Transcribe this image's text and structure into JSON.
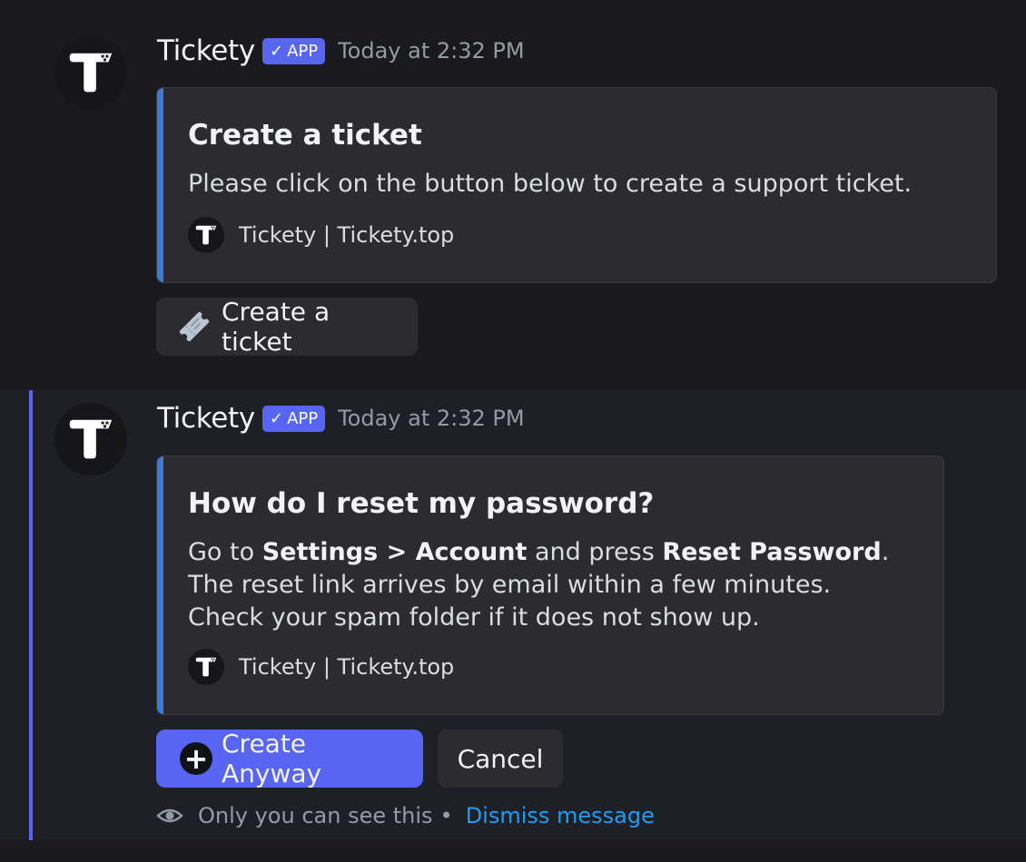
{
  "messages": [
    {
      "author": "Tickety",
      "badge": "APP",
      "badge_icon": "✓",
      "timestamp": "Today at 2:32 PM",
      "embed": {
        "title": "Create a ticket",
        "description": "Please click on the button below to create a support ticket.",
        "footer": "Tickety | Tickety.top",
        "accent_color": "#3a7bd5"
      },
      "buttons": [
        {
          "label": "Create a ticket",
          "icon": "ticket-icon",
          "style": "secondary"
        }
      ]
    },
    {
      "author": "Tickety",
      "badge": "APP",
      "badge_icon": "✓",
      "timestamp": "Today at 2:32 PM",
      "embed": {
        "title": "How do I reset my password?",
        "line1_prefix": "Go to ",
        "line1_bold1": "Settings > Account",
        "line1_mid": " and press ",
        "line1_bold2": "Reset Password",
        "line1_suffix": ".",
        "line2": "The reset link arrives by email within a few minutes.",
        "line3": "Check your spam folder if it does not show up.",
        "footer": "Tickety | Tickety.top",
        "accent_color": "#3a7bd5"
      },
      "buttons": [
        {
          "label": "Create Anyway",
          "icon": "plus-icon",
          "style": "primary"
        },
        {
          "label": "Cancel",
          "style": "secondary"
        }
      ],
      "ephemeral": {
        "notice": "Only you can see this",
        "separator": "•",
        "dismiss_label": "Dismiss message"
      }
    }
  ],
  "colors": {
    "brand": "#5865f2",
    "link": "#1e9ef0",
    "background": "#1a1a1e"
  }
}
